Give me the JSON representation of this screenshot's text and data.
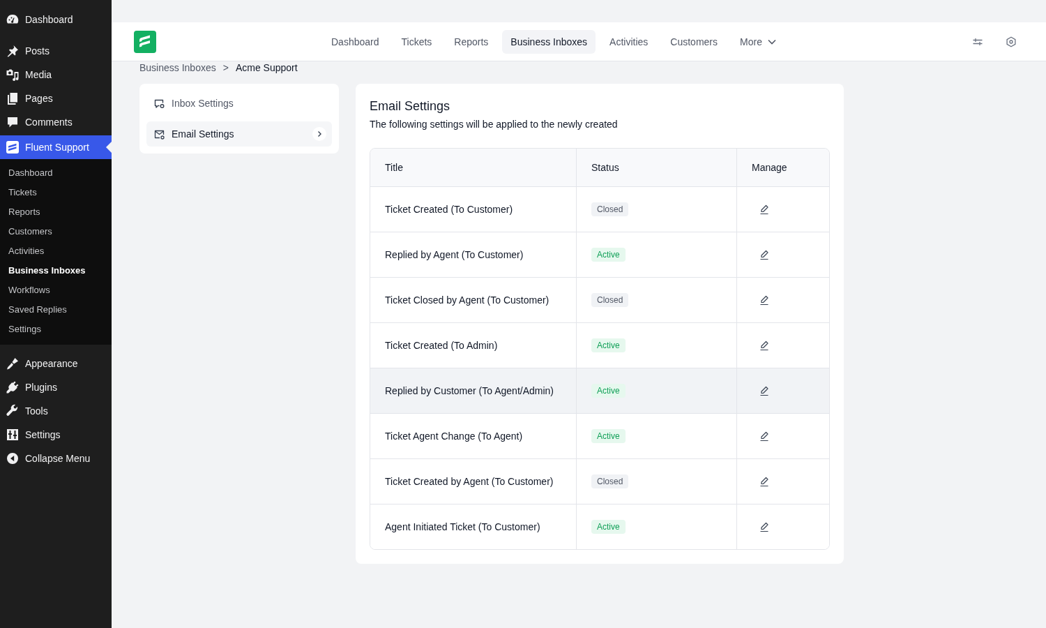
{
  "admin_menu": {
    "items": [
      {
        "label": "Dashboard",
        "selected": false
      },
      {
        "label": "Posts",
        "selected": false
      },
      {
        "label": "Media",
        "selected": false
      },
      {
        "label": "Pages",
        "selected": false
      },
      {
        "label": "Comments",
        "selected": false
      },
      {
        "label": "Fluent Support",
        "selected": true,
        "submenu": [
          {
            "label": "Dashboard",
            "selected": false
          },
          {
            "label": "Tickets",
            "selected": false
          },
          {
            "label": "Reports",
            "selected": false
          },
          {
            "label": "Customers",
            "selected": false
          },
          {
            "label": "Activities",
            "selected": false
          },
          {
            "label": "Business Inboxes",
            "selected": true
          },
          {
            "label": "Workflows",
            "selected": false
          },
          {
            "label": "Saved Replies",
            "selected": false
          },
          {
            "label": "Settings",
            "selected": false
          }
        ]
      },
      {
        "label": "Appearance",
        "selected": false
      },
      {
        "label": "Plugins",
        "selected": false
      },
      {
        "label": "Tools",
        "selected": false
      },
      {
        "label": "Settings",
        "selected": false
      }
    ],
    "collapse_button": {
      "label": "Collapse Menu"
    }
  },
  "top_nav": {
    "items": [
      {
        "label": "Dashboard",
        "selected": false,
        "kind": "link"
      },
      {
        "label": "Tickets",
        "selected": false,
        "kind": "link"
      },
      {
        "label": "Reports",
        "selected": false,
        "kind": "link"
      },
      {
        "label": "Business Inboxes",
        "selected": true,
        "kind": "link"
      },
      {
        "label": "Activities",
        "selected": false,
        "kind": "link"
      },
      {
        "label": "Customers",
        "selected": false,
        "kind": "link"
      },
      {
        "label": "More",
        "selected": false,
        "kind": "dropdown"
      }
    ]
  },
  "breadcrumb": {
    "items": [
      "Business Inboxes",
      "Acme Support"
    ],
    "separator": ">"
  },
  "settings_menu": {
    "items": [
      {
        "label": "Inbox Settings",
        "selected": false
      },
      {
        "label": "Email Settings",
        "selected": true
      }
    ]
  },
  "email_settings": {
    "title": "Email Settings",
    "subtitle": "The following settings will be applied to the newly created",
    "table": {
      "columns": [
        "Title",
        "Status",
        "Manage"
      ],
      "rows": [
        {
          "title": "Ticket Created (To Customer)",
          "status": "Closed",
          "active": false,
          "hovered": false
        },
        {
          "title": "Replied by Agent (To Customer)",
          "status": "Active",
          "active": true,
          "hovered": false
        },
        {
          "title": "Ticket Closed by Agent (To Customer)",
          "status": "Closed",
          "active": false,
          "hovered": false
        },
        {
          "title": "Ticket Created (To Admin)",
          "status": "Active",
          "active": true,
          "hovered": false
        },
        {
          "title": "Replied by Customer (To Agent/Admin)",
          "status": "Active",
          "active": true,
          "hovered": true
        },
        {
          "title": "Ticket Agent Change (To Agent)",
          "status": "Active",
          "active": true,
          "hovered": false
        },
        {
          "title": "Ticket Created by Agent (To Customer)",
          "status": "Closed",
          "active": false,
          "hovered": false
        },
        {
          "title": "Agent Initiated Ticket (To Customer)",
          "status": "Active",
          "active": true,
          "hovered": false
        }
      ]
    }
  }
}
